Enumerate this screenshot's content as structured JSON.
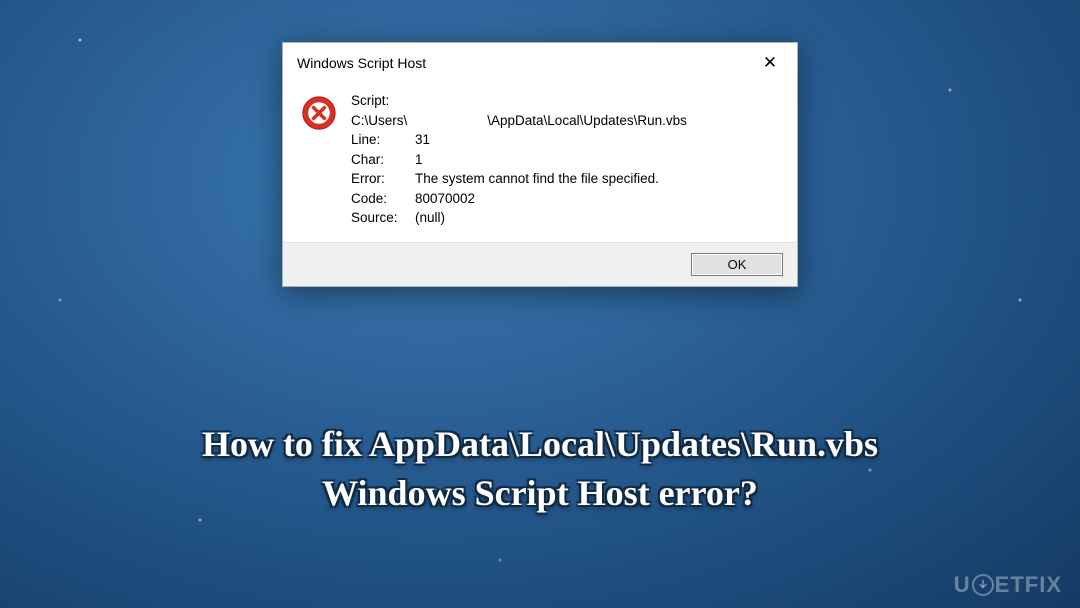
{
  "dialog": {
    "title": "Windows Script Host",
    "close_symbol": "✕",
    "script_label": "Script:",
    "path_prefix": "C:\\Users\\",
    "path_suffix": "\\AppData\\Local\\Updates\\Run.vbs",
    "fields": {
      "line": {
        "label": "Line:",
        "value": "31"
      },
      "char": {
        "label": "Char:",
        "value": "1"
      },
      "error": {
        "label": "Error:",
        "value": "The system cannot find the file specified."
      },
      "code": {
        "label": "Code:",
        "value": "80070002"
      },
      "source": {
        "label": "Source:",
        "value": "(null)"
      }
    },
    "ok_label": "OK"
  },
  "caption": {
    "line1": "How to fix AppData\\Local\\Updates\\Run.vbs",
    "line2": "Windows Script Host error?"
  },
  "watermark": {
    "pre": "U",
    "post": "ETFIX"
  }
}
